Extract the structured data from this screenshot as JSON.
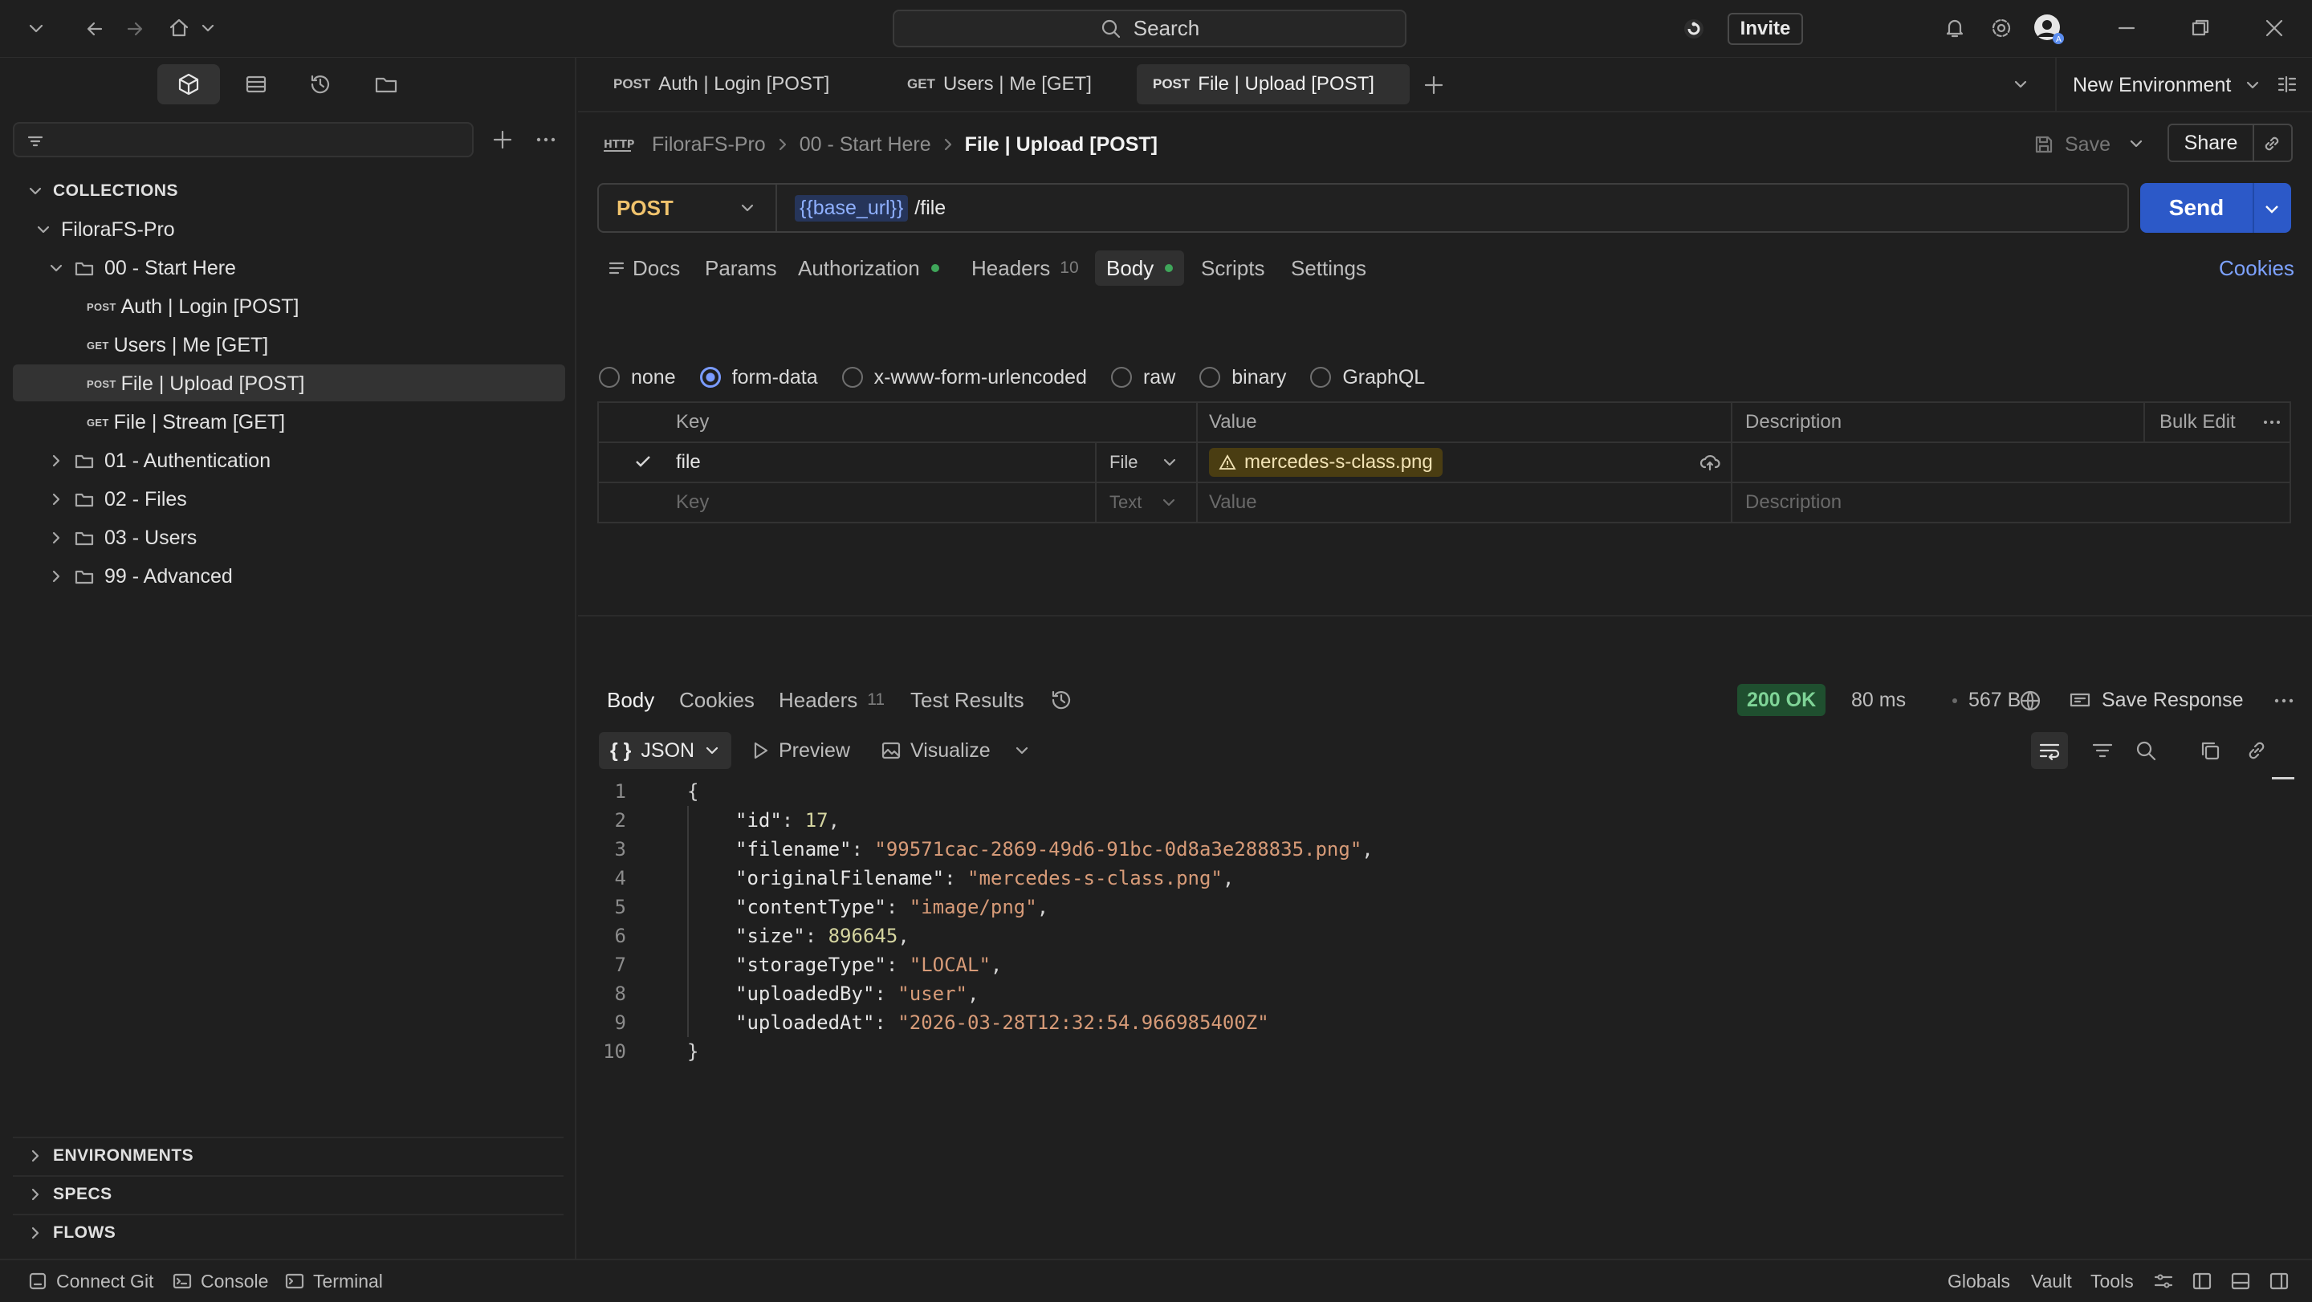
{
  "topbar": {
    "search_label": "Search",
    "invite_label": "Invite"
  },
  "sidebar": {
    "collections_title": "COLLECTIONS",
    "collection_name": "FiloraFS-Pro",
    "folder_open": "00 - Start Here",
    "requests": [
      {
        "method": "POST",
        "label": "Auth | Login [POST]"
      },
      {
        "method": "GET",
        "label": "Users | Me [GET]"
      },
      {
        "method": "POST",
        "label": "File | Upload [POST]"
      },
      {
        "method": "GET",
        "label": "File | Stream [GET]"
      }
    ],
    "folders": [
      "01 - Authentication",
      "02 - Files",
      "03 - Users",
      "99 - Advanced"
    ],
    "bottom_sections": [
      "ENVIRONMENTS",
      "SPECS",
      "FLOWS"
    ]
  },
  "tabs": [
    {
      "method": "POST",
      "label": "Auth | Login [POST]"
    },
    {
      "method": "GET",
      "label": "Users | Me [GET]"
    },
    {
      "method": "POST",
      "label": "File | Upload [POST]"
    }
  ],
  "environment": "New Environment",
  "breadcrumb": {
    "collection": "FiloraFS-Pro",
    "folder": "00 - Start Here",
    "current": "File | Upload [POST]"
  },
  "actions": {
    "save": "Save",
    "share": "Share"
  },
  "request": {
    "method": "POST",
    "url_var": "{{base_url}}",
    "url_path": "/file",
    "send_label": "Send"
  },
  "request_tabs": {
    "docs": "Docs",
    "params": "Params",
    "authorization": "Authorization",
    "headers": "Headers",
    "headers_count": "10",
    "body": "Body",
    "scripts": "Scripts",
    "settings": "Settings",
    "cookies": "Cookies"
  },
  "body_types": [
    "none",
    "form-data",
    "x-www-form-urlencoded",
    "raw",
    "binary",
    "GraphQL"
  ],
  "body_type_selected": "form-data",
  "form_table": {
    "headers": {
      "key": "Key",
      "value": "Value",
      "description": "Description",
      "bulk_edit": "Bulk Edit"
    },
    "rows": [
      {
        "checked": true,
        "key": "file",
        "type": "File",
        "value": "mercedes-s-class.png"
      }
    ],
    "placeholder": {
      "key": "Key",
      "type": "Text",
      "value": "Value",
      "description": "Description"
    }
  },
  "response": {
    "tabs": {
      "body": "Body",
      "cookies": "Cookies",
      "headers": "Headers",
      "headers_count": "11",
      "test_results": "Test Results"
    },
    "status": "200 OK",
    "time": "80 ms",
    "size": "567 B",
    "save_response": "Save Response",
    "format": "JSON",
    "preview": "Preview",
    "visualize": "Visualize",
    "line_numbers": [
      "1",
      "2",
      "3",
      "4",
      "5",
      "6",
      "7",
      "8",
      "9",
      "10"
    ],
    "json": {
      "id": "17",
      "filename": "\"99571cac-2869-49d6-91bc-0d8a3e288835.png\"",
      "originalFilename": "\"mercedes-s-class.png\"",
      "contentType": "\"image/png\"",
      "size": "896645",
      "storageType": "\"LOCAL\"",
      "uploadedBy": "\"user\"",
      "uploadedAt": "\"2026-03-28T12:32:54.966985400Z\""
    }
  },
  "statusbar": {
    "connect_git": "Connect Git",
    "console": "Console",
    "terminal": "Terminal",
    "globals": "Globals",
    "vault": "Vault",
    "tools": "Tools"
  }
}
